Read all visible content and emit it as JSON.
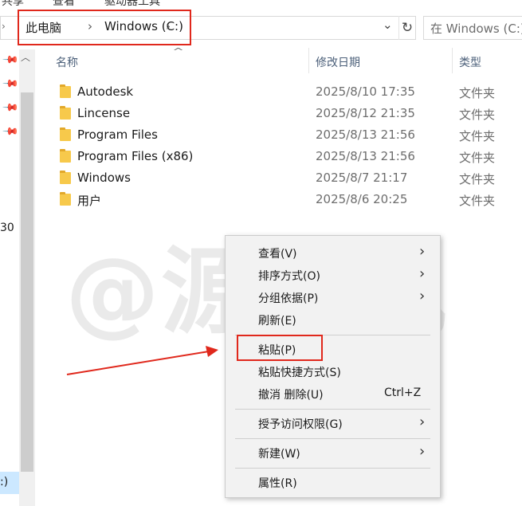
{
  "ribbon": {
    "tab_share": "共享",
    "tab_view": "查看",
    "tab_drive_tools": "驱动器工具"
  },
  "address": {
    "breadcrumbs": [
      "此电脑",
      "Windows (C:)"
    ],
    "separator": "›",
    "search_placeholder": "在 Windows (C:)"
  },
  "nav_pane": {
    "fragment_1": "30",
    "fragment_2": ":)"
  },
  "columns": {
    "name": "名称",
    "date": "修改日期",
    "type": "类型"
  },
  "files": [
    {
      "name": "Autodesk",
      "date": "2025/8/10 17:35",
      "type": "文件夹"
    },
    {
      "name": "Lincense",
      "date": "2025/8/12 21:35",
      "type": "文件夹"
    },
    {
      "name": "Program Files",
      "date": "2025/8/13 21:56",
      "type": "文件夹"
    },
    {
      "name": "Program Files (x86)",
      "date": "2025/8/13 21:56",
      "type": "文件夹"
    },
    {
      "name": "Windows",
      "date": "2025/8/7 21:17",
      "type": "文件夹"
    },
    {
      "name": "用户",
      "date": "2025/8/6 20:25",
      "type": "文件夹"
    }
  ],
  "watermark": "@源于风",
  "context_menu": {
    "view": "查看(V)",
    "sort": "排序方式(O)",
    "group": "分组依据(P)",
    "refresh": "刷新(E)",
    "paste": "粘贴(P)",
    "paste_shortcut": "粘贴快捷方式(S)",
    "undo_delete": "撤消 删除(U)",
    "undo_delete_key": "Ctrl+Z",
    "grant_access": "授予访问权限(G)",
    "new": "新建(W)",
    "properties": "属性(R)",
    "submenu_arrow": "›"
  },
  "colors": {
    "highlight": "#e0281c",
    "folder": "#f7c94b",
    "menu_bg": "#f2f2f2"
  },
  "icons": [
    "pin-icon",
    "folder-icon",
    "refresh-icon",
    "chevron-down-icon",
    "chevron-right-icon"
  ]
}
